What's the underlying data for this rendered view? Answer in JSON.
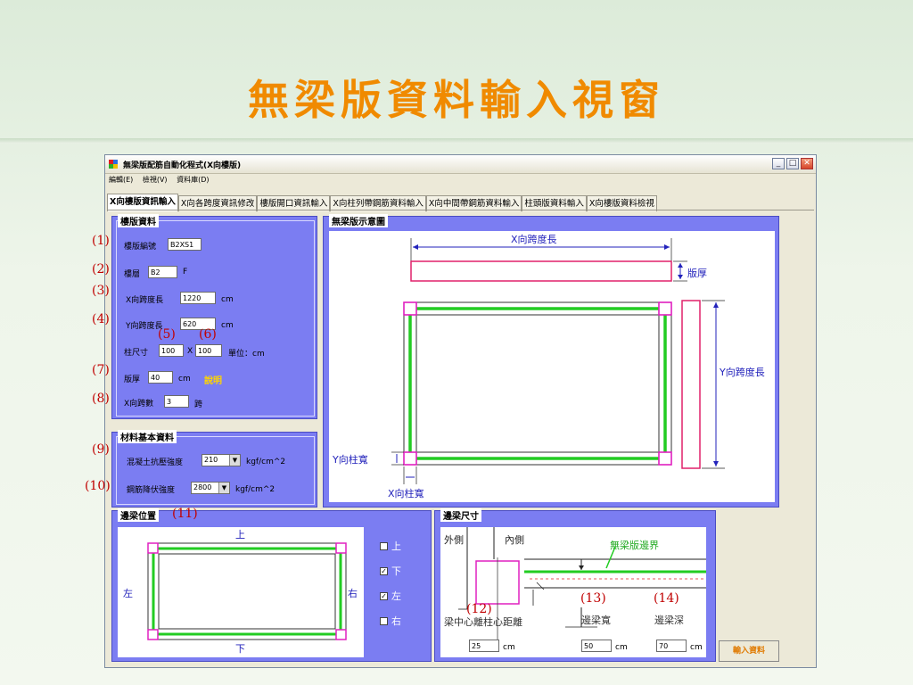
{
  "slide": {
    "title": "無梁版資料輸入視窗"
  },
  "window": {
    "title": "無梁版配筋自動化程式(X向樓版)",
    "icons": {
      "minimize": "minimize-icon",
      "maximize": "maximize-icon",
      "close": "close-icon"
    },
    "menu": [
      "編輯(E)",
      "檢視(V)",
      "資料庫(D)"
    ]
  },
  "tabs": [
    {
      "label": "X向樓版資訊輸入"
    },
    {
      "label": "X向各跨度資訊修改"
    },
    {
      "label": "樓版開口資訊輸入"
    },
    {
      "label": "X向柱列帶鋼筋資料輸入"
    },
    {
      "label": "X向中間帶鋼筋資料輸入"
    },
    {
      "label": "柱頭版資料輸入"
    },
    {
      "label": "X向樓版資料檢視"
    }
  ],
  "slab_info": {
    "title": "樓版資料",
    "slab_id_label": "樓版編號",
    "slab_id": "B2XS1",
    "floor_label": "樓層",
    "floor": "B2",
    "floor_unit": "F",
    "x_span_label": "X向跨度長",
    "x_span": "1220",
    "x_span_unit": "cm",
    "y_span_label": "Y向跨度長",
    "y_span": "620",
    "y_span_unit": "cm",
    "column_label": "柱尺寸",
    "column_x": "100",
    "column_sep": "X",
    "column_y": "100",
    "column_unit": "單位：cm",
    "thickness_label": "版厚",
    "thickness": "40",
    "thickness_unit": "cm",
    "explain_link": "說明",
    "span_count_label": "X向跨數",
    "span_count": "3",
    "span_count_unit": "跨"
  },
  "material": {
    "title": "材料基本資料",
    "fc_label": "混凝土抗壓強度",
    "fc": "210",
    "fc_unit": "kgf/cm^2",
    "fy_label": "鋼筋降伏強度",
    "fy": "2800",
    "fy_unit": "kgf/cm^2"
  },
  "schematic": {
    "title": "無梁版示意圖",
    "x_span": "X向跨度長",
    "thickness": "版厚",
    "y_span": "Y向跨度長",
    "y_col": "Y向柱寬",
    "x_col": "X向柱寬"
  },
  "edge_position": {
    "title": "邊梁位置",
    "top": "上",
    "bottom": "下",
    "left": "左",
    "right": "右",
    "checks": [
      {
        "label": "上",
        "checked": false
      },
      {
        "label": "下",
        "checked": true
      },
      {
        "label": "左",
        "checked": true
      },
      {
        "label": "右",
        "checked": false
      }
    ]
  },
  "edge_size": {
    "title": "邊梁尺寸",
    "outer": "外側",
    "inner": "內側",
    "boundary": "無梁版邊界",
    "dist_label": "梁中心離柱心距離",
    "width_label": "邊梁寬",
    "depth_label": "邊梁深",
    "dist": "25",
    "dist_unit": "cm",
    "width": "50",
    "width_unit": "cm",
    "depth": "70",
    "depth_unit": "cm"
  },
  "markers": [
    "(1)",
    "(2)",
    "(3)",
    "(4)",
    "(5)",
    "(6)",
    "(7)",
    "(8)",
    "(9)",
    "(10)",
    "(11)",
    "(12)",
    "(13)",
    "(14)"
  ],
  "submit_label": "輸入資料",
  "colors": {
    "accent": "#f08a00",
    "panel": "#7b7df2",
    "marker": "#c00000",
    "link": "#ffd400"
  }
}
